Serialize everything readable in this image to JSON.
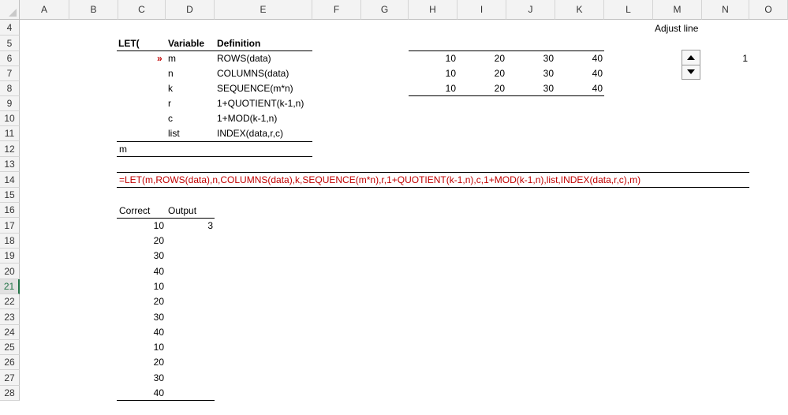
{
  "columns": [
    "A",
    "B",
    "C",
    "D",
    "E",
    "F",
    "G",
    "H",
    "I",
    "J",
    "K",
    "L",
    "M",
    "N",
    "O"
  ],
  "rows": [
    "4",
    "5",
    "6",
    "7",
    "8",
    "9",
    "10",
    "11",
    "12",
    "13",
    "14",
    "15",
    "16",
    "17",
    "18",
    "19",
    "20",
    "21",
    "22",
    "23",
    "24",
    "25",
    "26",
    "27",
    "28"
  ],
  "selected_row": "21",
  "let_table": {
    "header": {
      "col1": "LET(",
      "col2": "Variable",
      "col3": "Definition"
    },
    "marker": "»",
    "rows": [
      {
        "variable": "m",
        "definition": "ROWS(data)"
      },
      {
        "variable": "n",
        "definition": "COLUMNS(data)"
      },
      {
        "variable": "k",
        "definition": "SEQUENCE(m*n)"
      },
      {
        "variable": "r",
        "definition": "1+QUOTIENT(k-1,n)"
      },
      {
        "variable": "c",
        "definition": "1+MOD(k-1,n)"
      },
      {
        "variable": "list",
        "definition": "INDEX(data,r,c)"
      }
    ],
    "result": "m"
  },
  "data_grid": [
    [
      "10",
      "20",
      "30",
      "40"
    ],
    [
      "10",
      "20",
      "30",
      "40"
    ],
    [
      "10",
      "20",
      "30",
      "40"
    ]
  ],
  "adjust": {
    "label": "Adjust line",
    "value": "1"
  },
  "formula": "=LET(m,ROWS(data),n,COLUMNS(data),k,SEQUENCE(m*n),r,1+QUOTIENT(k-1,n),c,1+MOD(k-1,n),list,INDEX(data,r,c),m)",
  "output_table": {
    "header_correct": "Correct",
    "header_output": "Output",
    "correct": [
      "10",
      "20",
      "30",
      "40",
      "10",
      "20",
      "30",
      "40",
      "10",
      "20",
      "30",
      "40"
    ],
    "output_first": "3"
  }
}
